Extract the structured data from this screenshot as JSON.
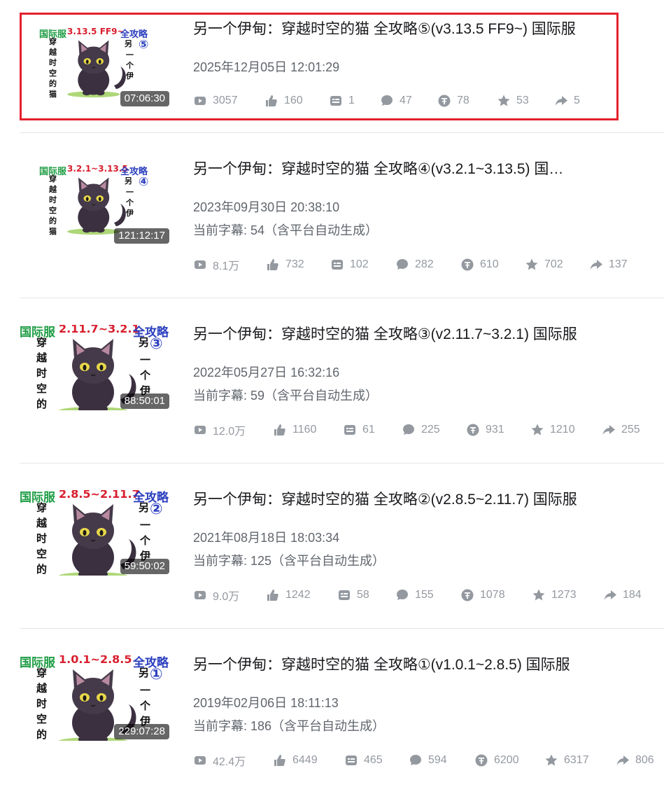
{
  "videos": [
    {
      "title": "另一个伊甸：穿越时空的猫 全攻略⑤(v3.13.5 FF9~) 国际服",
      "date": "2025年12月05日 12:01:29",
      "subtitle_text": "",
      "duration": "07:06:30",
      "cover": {
        "server": "国际服",
        "version": "3.13.5  FF9~",
        "guide": "全攻略",
        "num": "⑤",
        "other": "另"
      },
      "stats": {
        "plays": "3057",
        "likes": "160",
        "danmaku": "1",
        "comments": "47",
        "coins": "78",
        "favorites": "53",
        "shares": "5"
      }
    },
    {
      "title": "另一个伊甸：穿越时空的猫 全攻略④(v3.2.1~3.13.5) 国…",
      "date": "2023年09月30日 20:38:10",
      "subtitle_text": "当前字幕: 54（含平台自动生成）",
      "duration": "121:12:17",
      "cover": {
        "server": "国际服",
        "version": "3.2.1~3.13.5",
        "guide": "全攻略",
        "num": "④",
        "other": "另"
      },
      "stats": {
        "plays": "8.1万",
        "likes": "732",
        "danmaku": "102",
        "comments": "282",
        "coins": "610",
        "favorites": "702",
        "shares": "137"
      }
    },
    {
      "title": "另一个伊甸：穿越时空的猫 全攻略③(v2.11.7~3.2.1) 国际服",
      "date": "2022年05月27日 16:32:16",
      "subtitle_text": "当前字幕: 59（含平台自动生成）",
      "duration": "88:50:01",
      "cover": {
        "server": "国际服",
        "version": "2.11.7~3.2.1",
        "guide": "全攻略",
        "num": "③",
        "other": "另"
      },
      "stats": {
        "plays": "12.0万",
        "likes": "1160",
        "danmaku": "61",
        "comments": "225",
        "coins": "931",
        "favorites": "1210",
        "shares": "255"
      }
    },
    {
      "title": "另一个伊甸：穿越时空的猫 全攻略②(v2.8.5~2.11.7) 国际服",
      "date": "2021年08月18日 18:03:34",
      "subtitle_text": "当前字幕: 125（含平台自动生成）",
      "duration": "59:50:02",
      "cover": {
        "server": "国际服",
        "version": "2.8.5~2.11.7",
        "guide": "全攻略",
        "num": "②",
        "other": "另"
      },
      "stats": {
        "plays": "9.0万",
        "likes": "1242",
        "danmaku": "58",
        "comments": "155",
        "coins": "1078",
        "favorites": "1273",
        "shares": "184"
      }
    },
    {
      "title": "另一个伊甸：穿越时空的猫 全攻略①(v1.0.1~2.8.5) 国际服",
      "date": "2019年02月06日 18:11:13",
      "subtitle_text": "当前字幕: 186（含平台自动生成）",
      "duration": "229:07:28",
      "cover": {
        "server": "国际服",
        "version": "1.0.1~2.8.5",
        "guide": "全攻略",
        "num": "①",
        "other": "另"
      },
      "stats": {
        "plays": "42.4万",
        "likes": "6449",
        "danmaku": "465",
        "comments": "594",
        "coins": "6200",
        "favorites": "6317",
        "shares": "806"
      }
    }
  ],
  "icons": {
    "plays": "play-icon",
    "likes": "thumb-up-icon",
    "danmaku": "danmaku-icon",
    "comments": "comment-icon",
    "coins": "coin-icon",
    "favorites": "star-icon",
    "shares": "share-icon"
  },
  "colors": {
    "highlight": "#e4202e",
    "muted": "#9499a0",
    "title": "#18191c"
  }
}
